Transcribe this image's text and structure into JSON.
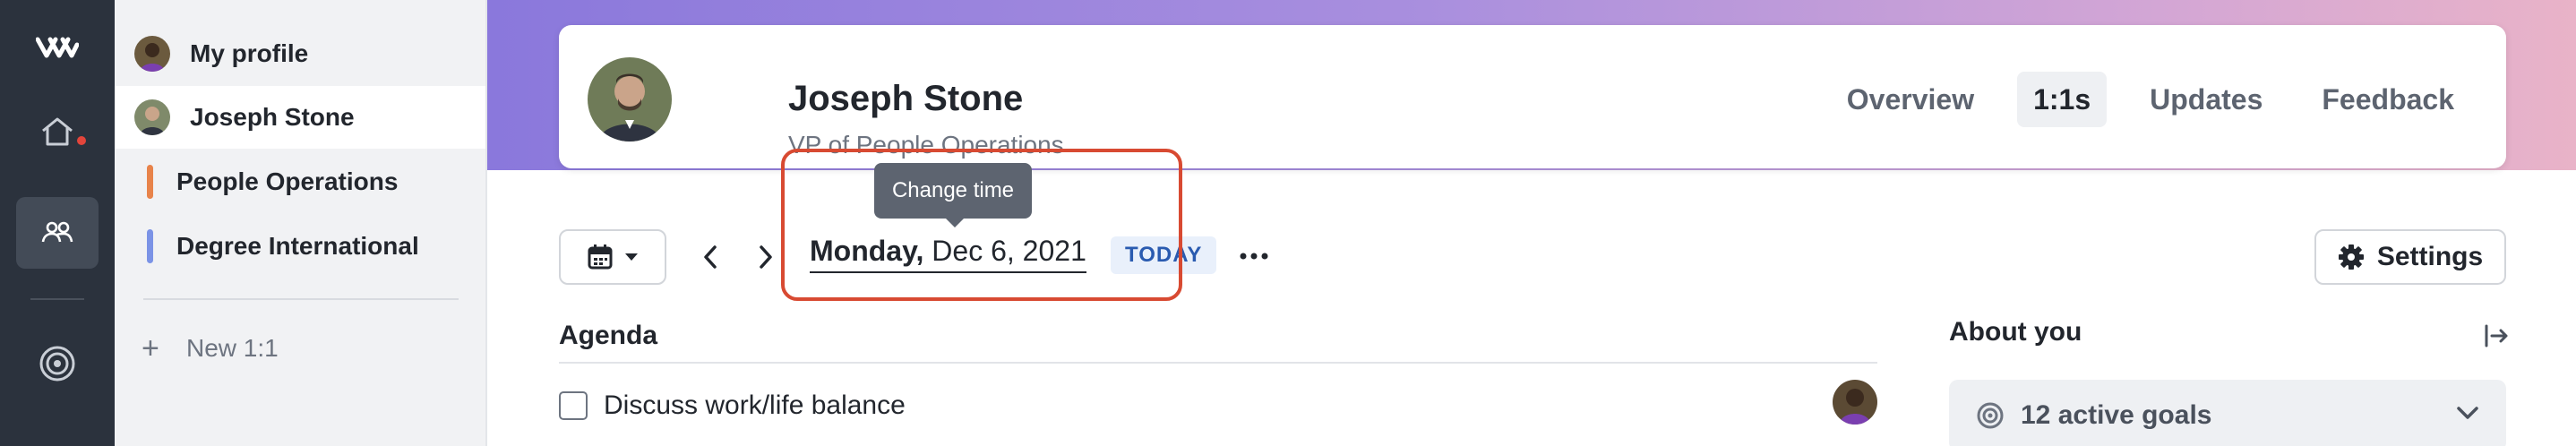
{
  "sidebar": {
    "items": [
      {
        "label": "My profile",
        "icon": "avatar"
      },
      {
        "label": "Joseph Stone",
        "icon": "avatar"
      },
      {
        "label": "People Operations",
        "icon": "color-bar",
        "color": "#e8834a"
      },
      {
        "label": "Degree International",
        "icon": "color-bar",
        "color": "#7b93e6"
      }
    ],
    "new_label": "New 1:1"
  },
  "rail": {
    "icons": [
      "logo-icon",
      "home-icon",
      "people-icon",
      "target-icon"
    ],
    "notification_color": "#e2453b"
  },
  "header": {
    "name": "Joseph Stone",
    "role": "VP of People Operations",
    "tabs": [
      {
        "label": "Overview",
        "active": false
      },
      {
        "label": "1:1s",
        "active": true
      },
      {
        "label": "Updates",
        "active": false
      },
      {
        "label": "Feedback",
        "active": false
      }
    ]
  },
  "toolbar": {
    "day": "Monday,",
    "date": " Dec 6, 2021",
    "today_label": "TODAY",
    "tooltip": "Change time",
    "settings_label": "Settings"
  },
  "agenda": {
    "title": "Agenda",
    "items": [
      {
        "label": "Discuss work/life balance",
        "checked": false
      }
    ]
  },
  "about": {
    "title": "About you",
    "goals_label": "12 active goals"
  },
  "colors": {
    "rail_bg": "#2b323d",
    "highlight": "#d84a32",
    "banner_start": "#8a78dc",
    "banner_end": "#e9b3c8"
  }
}
